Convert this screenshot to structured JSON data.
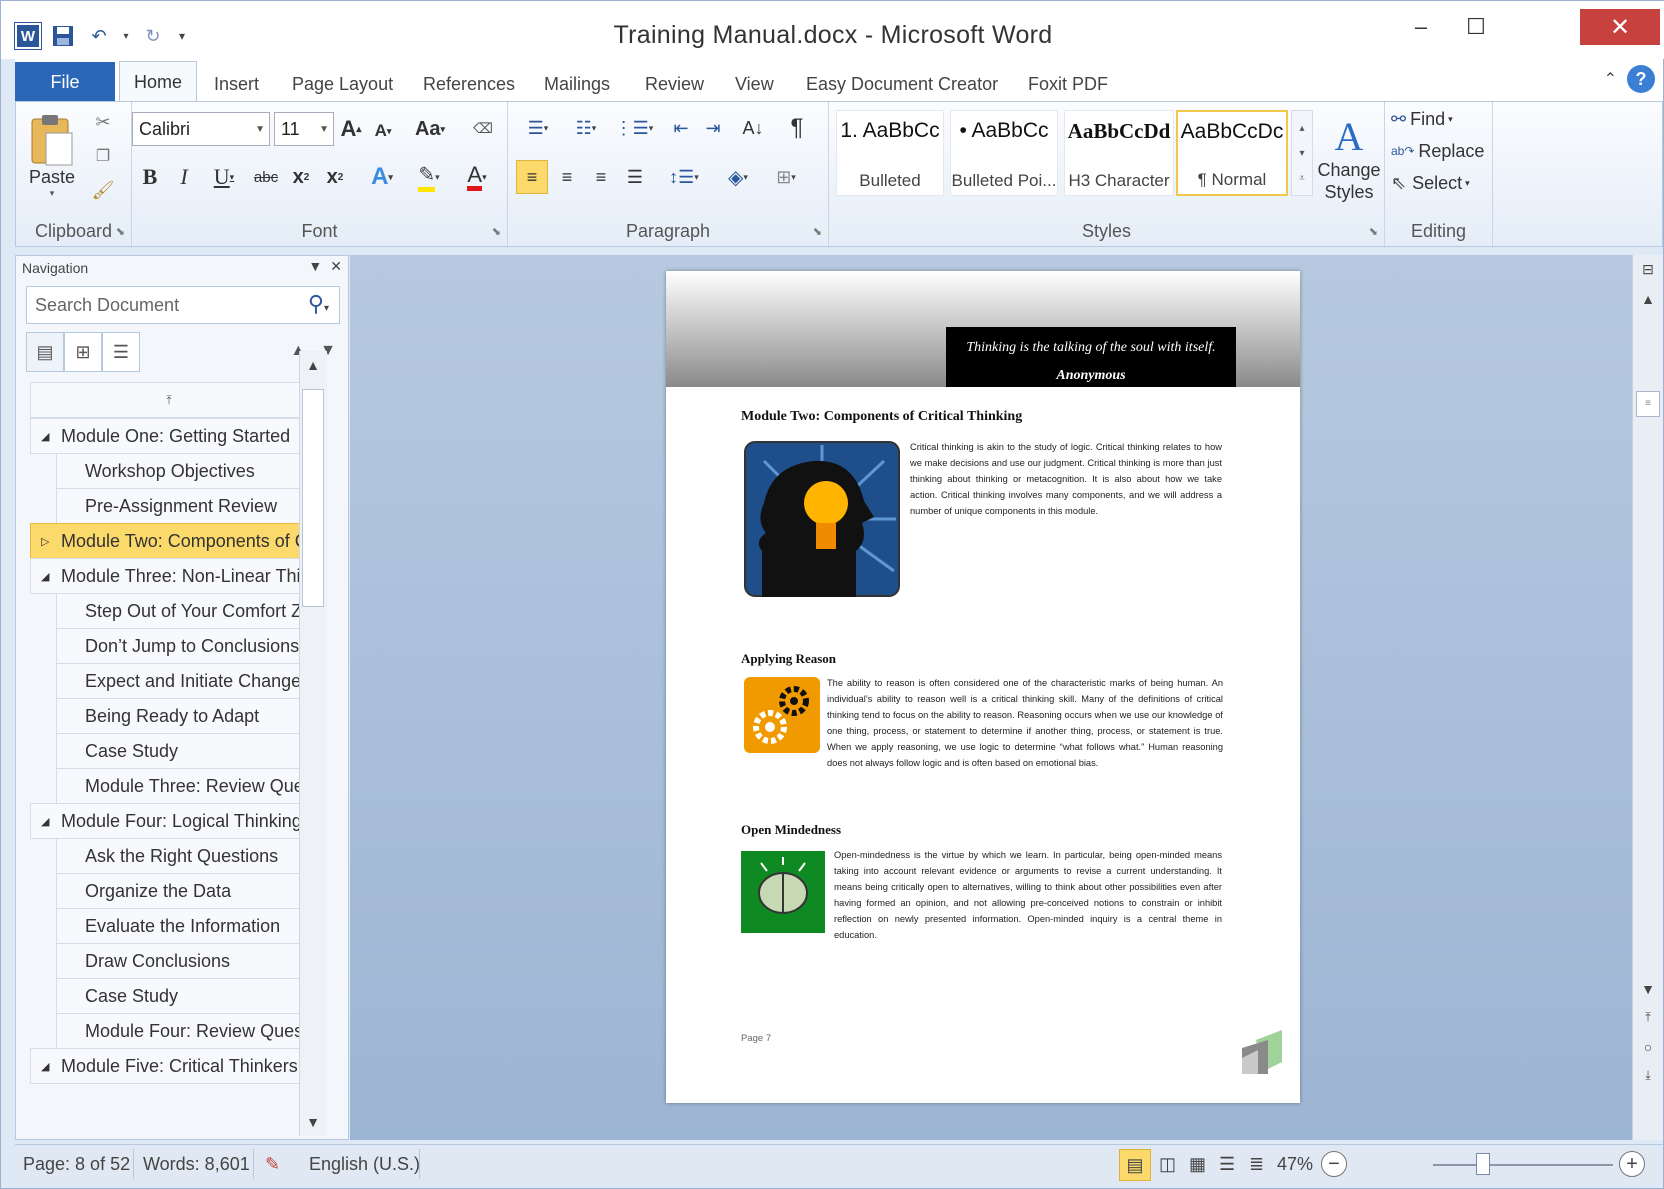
{
  "window": {
    "title": "Training Manual.docx - Microsoft Word"
  },
  "qat": {
    "logo": "W",
    "save_icon": "save-icon",
    "undo_icon": "undo-icon",
    "redo_icon": "redo-icon"
  },
  "controls": {
    "minimize": "–",
    "maximize": "☐",
    "close": "✕"
  },
  "tabs": {
    "file": "File",
    "items": [
      "Home",
      "Insert",
      "Page Layout",
      "References",
      "Mailings",
      "Review",
      "View",
      "Easy Document Creator",
      "Foxit PDF"
    ]
  },
  "ribbon": {
    "clipboard": {
      "label": "Clipboard",
      "paste": "Paste"
    },
    "font": {
      "label": "Font",
      "name": "Calibri",
      "size": "11"
    },
    "paragraph": {
      "label": "Paragraph"
    },
    "styles": {
      "label": "Styles",
      "items": [
        {
          "preview": "1. AaBbCc",
          "name": "Bulleted"
        },
        {
          "preview": "• AaBbCc",
          "name": "Bulleted Poi..."
        },
        {
          "preview": "AaBbCcDd",
          "name": "H3 Character"
        },
        {
          "preview": "AaBbCcDc",
          "name": "¶ Normal"
        }
      ],
      "change_styles": "Change Styles"
    },
    "editing": {
      "label": "Editing",
      "find": "Find",
      "replace": "Replace",
      "select": "Select"
    }
  },
  "navigation": {
    "title": "Navigation",
    "search_placeholder": "Search Document",
    "items": [
      {
        "text": "Module One: Getting Started",
        "level": 1,
        "tri": "◢"
      },
      {
        "text": "Workshop Objectives",
        "level": 2
      },
      {
        "text": "Pre-Assignment Review",
        "level": 2
      },
      {
        "text": "Module Two: Components of C...",
        "level": 1,
        "tri": "▷",
        "selected": true
      },
      {
        "text": "Module Three: Non-Linear Thi...",
        "level": 1,
        "tri": "◢"
      },
      {
        "text": "Step Out of Your Comfort Z...",
        "level": 2
      },
      {
        "text": "Don’t Jump to Conclusions",
        "level": 2
      },
      {
        "text": "Expect and Initiate Change",
        "level": 2
      },
      {
        "text": "Being Ready to Adapt",
        "level": 2
      },
      {
        "text": "Case Study",
        "level": 2
      },
      {
        "text": "Module Three: Review Que...",
        "level": 2
      },
      {
        "text": "Module Four: Logical Thinking",
        "level": 1,
        "tri": "◢"
      },
      {
        "text": "Ask the Right Questions",
        "level": 2
      },
      {
        "text": "Organize the Data",
        "level": 2
      },
      {
        "text": "Evaluate the Information",
        "level": 2
      },
      {
        "text": "Draw Conclusions",
        "level": 2
      },
      {
        "text": "Case Study",
        "level": 2
      },
      {
        "text": "Module Four: Review Quest...",
        "level": 2
      },
      {
        "text": "Module Five: Critical Thinkers (I)",
        "level": 1,
        "tri": "◢"
      }
    ]
  },
  "document": {
    "quote": "Thinking is the talking of the soul with itself.",
    "quote_author": "Anonymous",
    "heading1": "Module Two: Components of Critical Thinking",
    "para1": "Critical thinking is akin to the study of logic. Critical thinking relates to how we make decisions and use our judgment. Critical thinking is more than just thinking about thinking or metacognition. It is also about how we take action. Critical thinking involves many components, and we will address a number of unique components in this module.",
    "heading2": "Applying Reason",
    "para2": "The ability to reason is often considered one of the characteristic marks of being human. An individual’s ability to reason well is a critical thinking skill. Many of the definitions of critical thinking tend to focus on the ability to reason. Reasoning occurs when we use our knowledge of one thing, process, or statement to determine if another thing, process, or statement is true. When we apply reasoning, we use logic to determine “what follows what.” Human reasoning does not always follow logic and is often based on emotional bias.",
    "heading3": "Open Mindedness",
    "para3": "Open-mindedness is the virtue by which we learn. In particular, being open-minded means taking into account relevant evidence or arguments to revise a current understanding. It means being critically open to alternatives, willing to think about other possibilities even after having formed an opinion, and not allowing pre-conceived notions to constrain or inhibit reflection on newly presented information. Open-minded inquiry is a central theme in education.",
    "footer": "Page 7"
  },
  "status": {
    "page": "Page: 8 of 52",
    "words": "Words: 8,601",
    "language": "English (U.S.)",
    "zoom": "47%"
  },
  "colors": {
    "accent": "#2b579a",
    "file_tab": "#2b66b8",
    "close": "#c7413e",
    "nav_selected": "#fbd96b"
  }
}
